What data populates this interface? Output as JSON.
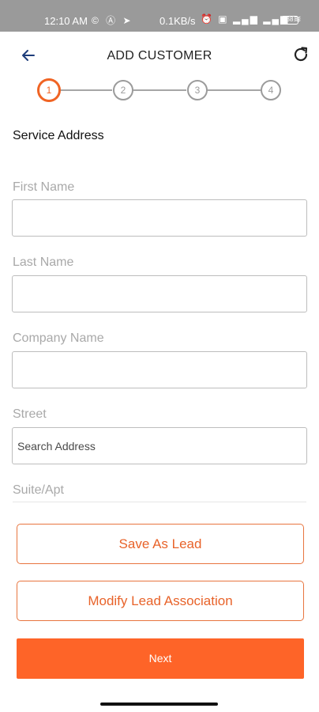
{
  "status_bar": {
    "time": "12:10 AM",
    "left_icons": "© Ⓐ ➤",
    "speed": "0.1KB/s",
    "right_icons": "⏰ ▣ ▂▄▆ ▂▄▆ ≋",
    "battery": "38"
  },
  "header": {
    "title": "ADD CUSTOMER",
    "back_icon": "arrow-left-icon",
    "refresh_icon": "refresh-icon"
  },
  "stepper": {
    "steps": [
      "1",
      "2",
      "3",
      "4"
    ],
    "active_step": 1,
    "accent_color": "#f06424"
  },
  "section": {
    "title": "Service Address"
  },
  "fields": {
    "first_name": {
      "label": "First Name",
      "value": ""
    },
    "last_name": {
      "label": "Last Name",
      "value": ""
    },
    "company_name": {
      "label": "Company Name",
      "value": ""
    },
    "street": {
      "label": "Street",
      "placeholder": "Search Address"
    },
    "suite_apt": {
      "label": "Suite/Apt"
    }
  },
  "buttons": {
    "save_as_lead": "Save As Lead",
    "modify_lead_association": "Modify Lead Association",
    "next": "Next"
  },
  "colors": {
    "brand": "#fe6428",
    "outline": "#e8753f"
  }
}
